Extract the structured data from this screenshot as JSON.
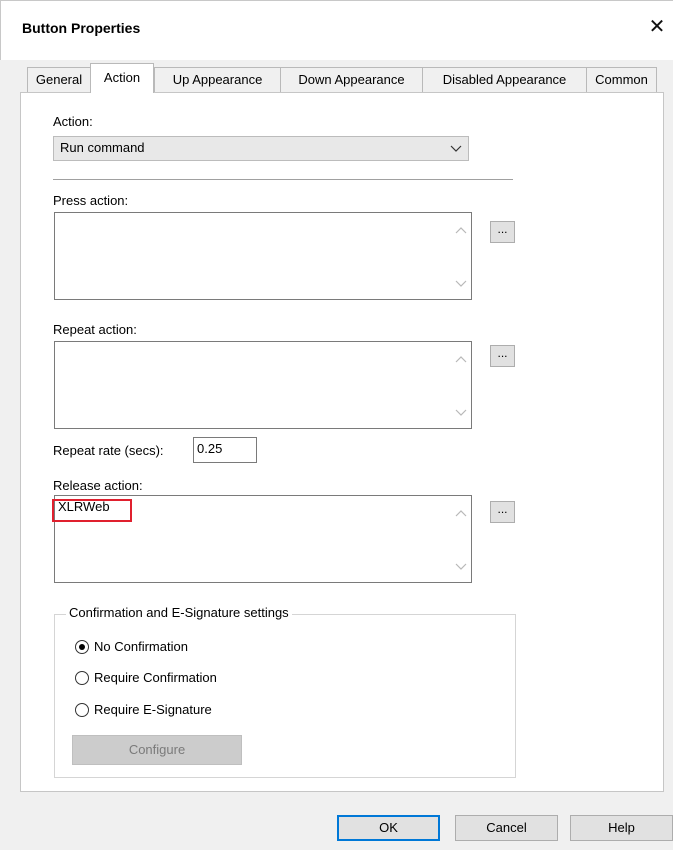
{
  "window": {
    "title": "Button Properties",
    "close_glyph": "✕"
  },
  "tabs": [
    {
      "label": "General",
      "active": false
    },
    {
      "label": "Action",
      "active": true
    },
    {
      "label": "Up Appearance",
      "active": false
    },
    {
      "label": "Down Appearance",
      "active": false
    },
    {
      "label": "Disabled Appearance",
      "active": false
    },
    {
      "label": "Common",
      "active": false
    }
  ],
  "action": {
    "label": "Action:",
    "selected": "Run command"
  },
  "press_action": {
    "label": "Press action:",
    "value": "",
    "browse_label": "..."
  },
  "repeat_action": {
    "label": "Repeat action:",
    "value": "",
    "browse_label": "..."
  },
  "repeat_rate": {
    "label": "Repeat rate (secs):",
    "value": "0.25"
  },
  "release_action": {
    "label": "Release action:",
    "value": "XLRWeb",
    "browse_label": "..."
  },
  "confirmation": {
    "legend": "Confirmation and E-Signature settings",
    "options": [
      {
        "label": "No Confirmation",
        "checked": true
      },
      {
        "label": "Require Confirmation",
        "checked": false
      },
      {
        "label": "Require E-Signature",
        "checked": false
      }
    ],
    "configure_label": "Configure"
  },
  "buttons": {
    "ok": "OK",
    "cancel": "Cancel",
    "help": "Help"
  },
  "colors": {
    "highlight": "#e0202e",
    "default_button_border": "#0078d7"
  }
}
